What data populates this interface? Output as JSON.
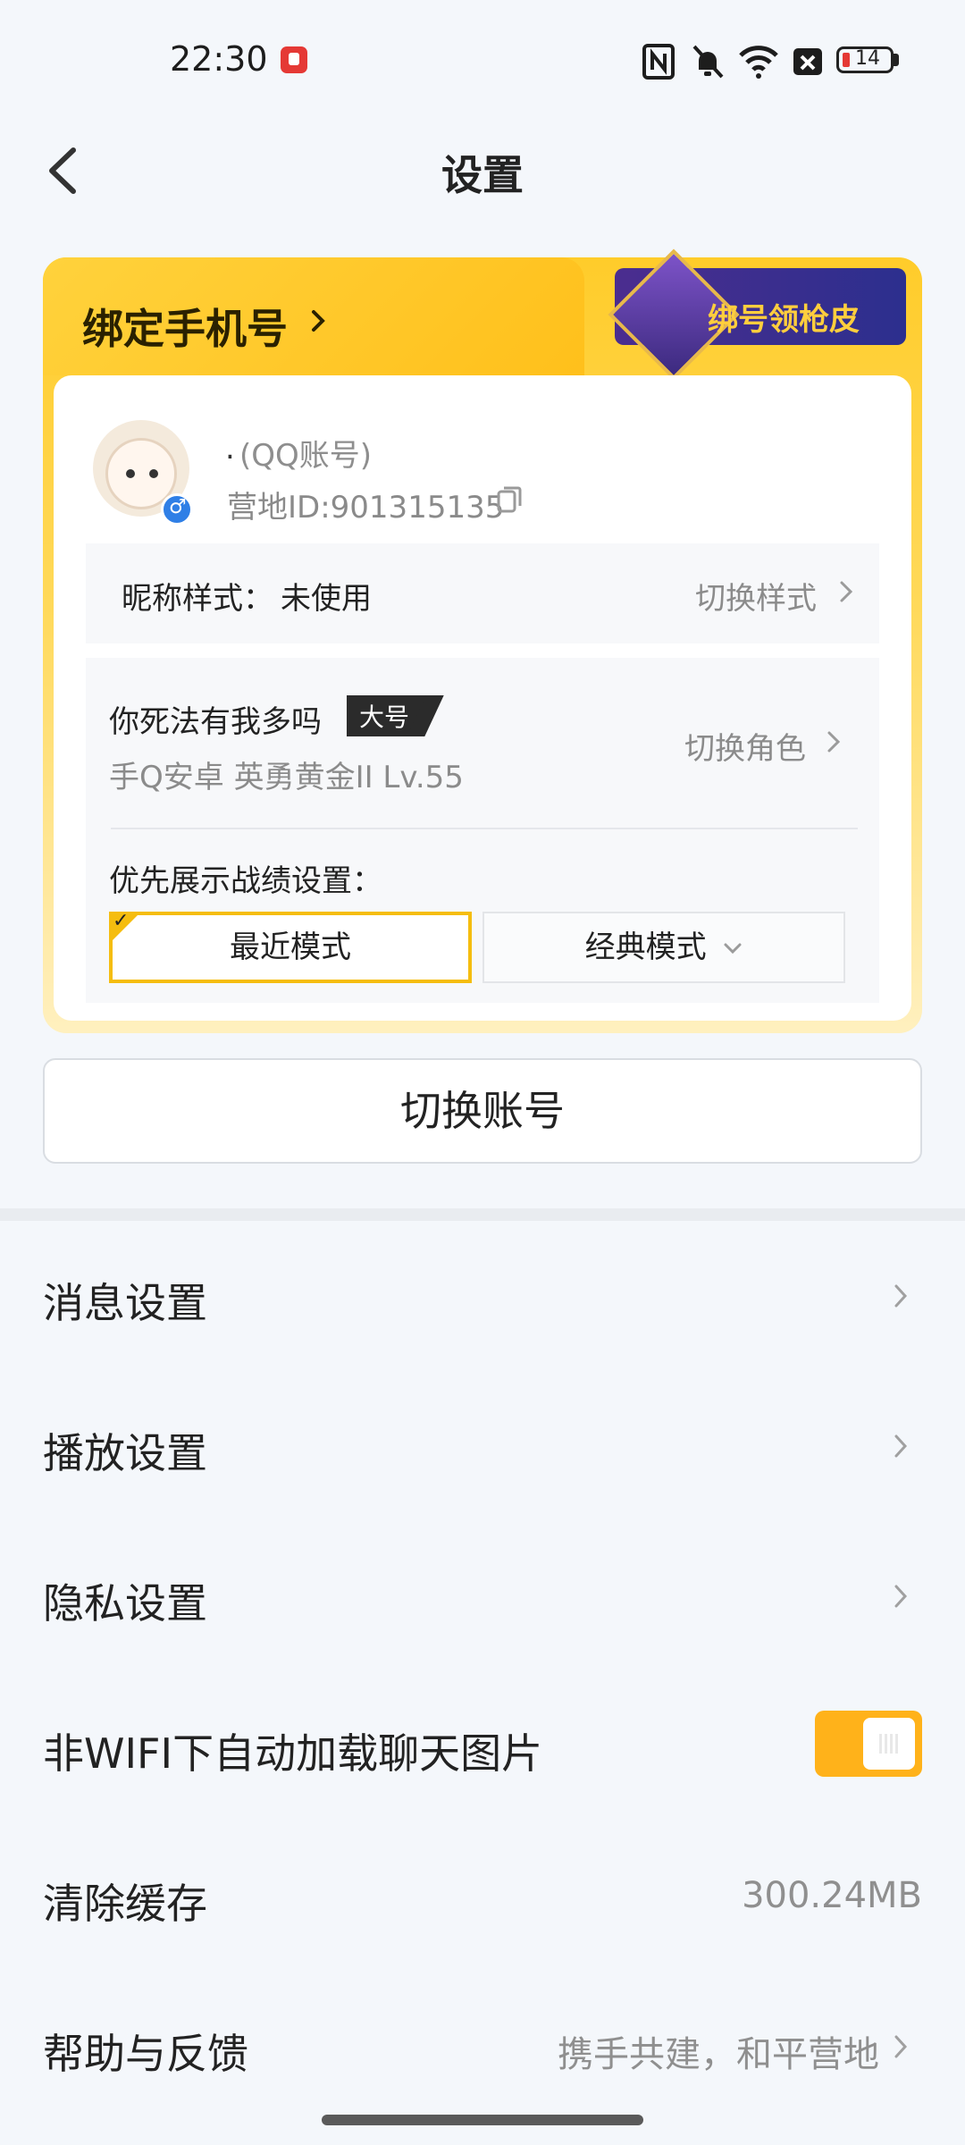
{
  "status_bar": {
    "time": "22:30",
    "battery_level": "14",
    "icons": [
      "app-notification-icon",
      "nfc-icon",
      "bell-muted-icon",
      "wifi-icon",
      "sim-x-icon",
      "battery-icon"
    ]
  },
  "header": {
    "title": "设置",
    "back_icon": "chevron-left-icon"
  },
  "card": {
    "bind_phone_label": "绑定手机号",
    "promo_label": "绑号领枪皮",
    "nickname": ".",
    "account_type": "(QQ账号)",
    "camp_id": "营地ID:901315135",
    "nick_style_label": "昵称样式：",
    "nick_style_value": "未使用",
    "switch_style_label": "切换样式",
    "role_name": "你死法有我多吗",
    "role_tag": "大号",
    "role_meta": "手Q安卓  英勇黄金II  Lv.55",
    "switch_role_label": "切换角色",
    "priority_label": "优先展示战绩设置：",
    "mode_recent": "最近模式",
    "mode_classic": "经典模式"
  },
  "switch_account_label": "切换账号",
  "settings": [
    {
      "label": "消息设置"
    },
    {
      "label": "播放设置"
    },
    {
      "label": "隐私设置"
    },
    {
      "label": "非WIFI下自动加载聊天图片",
      "toggle_on": true
    },
    {
      "label": "清除缓存",
      "value": "300.24MB"
    },
    {
      "label": "帮助与反馈",
      "value": "携手共建，和平营地"
    }
  ],
  "colors": {
    "accent": "#ffb21a",
    "card_yellow": "#ffcc2a",
    "promo_purple": "#4b2d8f",
    "gender_blue": "#2f7fe6"
  }
}
